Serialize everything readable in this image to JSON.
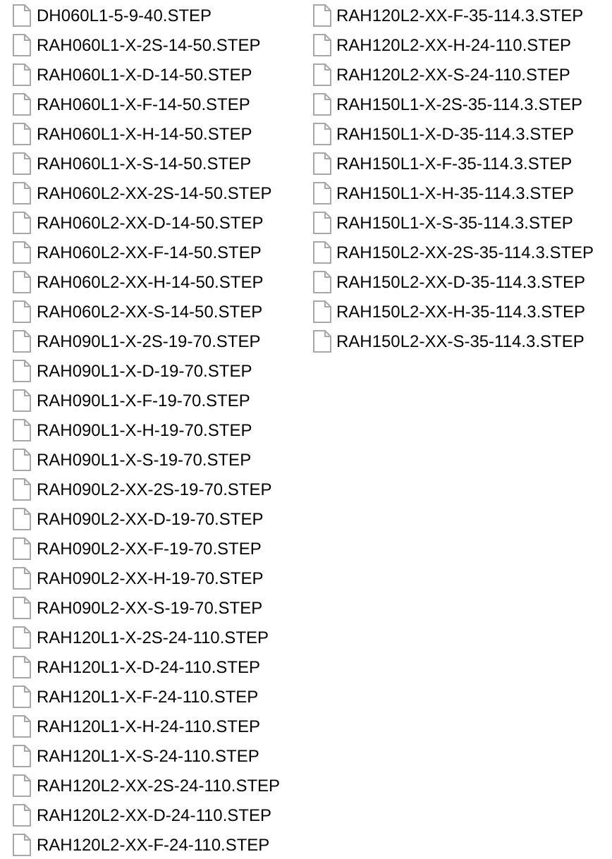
{
  "columns": [
    {
      "files": [
        "DH060L1-5-9-40.STEP",
        "RAH060L1-X-2S-14-50.STEP",
        "RAH060L1-X-D-14-50.STEP",
        "RAH060L1-X-F-14-50.STEP",
        "RAH060L1-X-H-14-50.STEP",
        "RAH060L1-X-S-14-50.STEP",
        "RAH060L2-XX-2S-14-50.STEP",
        "RAH060L2-XX-D-14-50.STEP",
        "RAH060L2-XX-F-14-50.STEP",
        "RAH060L2-XX-H-14-50.STEP",
        "RAH060L2-XX-S-14-50.STEP",
        "RAH090L1-X-2S-19-70.STEP",
        "RAH090L1-X-D-19-70.STEP",
        "RAH090L1-X-F-19-70.STEP",
        "RAH090L1-X-H-19-70.STEP",
        "RAH090L1-X-S-19-70.STEP",
        "RAH090L2-XX-2S-19-70.STEP",
        "RAH090L2-XX-D-19-70.STEP",
        "RAH090L2-XX-F-19-70.STEP",
        "RAH090L2-XX-H-19-70.STEP",
        "RAH090L2-XX-S-19-70.STEP",
        "RAH120L1-X-2S-24-110.STEP",
        "RAH120L1-X-D-24-110.STEP",
        "RAH120L1-X-F-24-110.STEP",
        "RAH120L1-X-H-24-110.STEP",
        "RAH120L1-X-S-24-110.STEP",
        "RAH120L2-XX-2S-24-110.STEP",
        "RAH120L2-XX-D-24-110.STEP",
        "RAH120L2-XX-F-24-110.STEP"
      ]
    },
    {
      "files": [
        "RAH120L2-XX-F-35-114.3.STEP",
        "RAH120L2-XX-H-24-110.STEP",
        "RAH120L2-XX-S-24-110.STEP",
        "RAH150L1-X-2S-35-114.3.STEP",
        "RAH150L1-X-D-35-114.3.STEP",
        "RAH150L1-X-F-35-114.3.STEP",
        "RAH150L1-X-H-35-114.3.STEP",
        "RAH150L1-X-S-35-114.3.STEP",
        "RAH150L2-XX-2S-35-114.3.STEP",
        "RAH150L2-XX-D-35-114.3.STEP",
        "RAH150L2-XX-H-35-114.3.STEP",
        "RAH150L2-XX-S-35-114.3.STEP"
      ]
    }
  ]
}
